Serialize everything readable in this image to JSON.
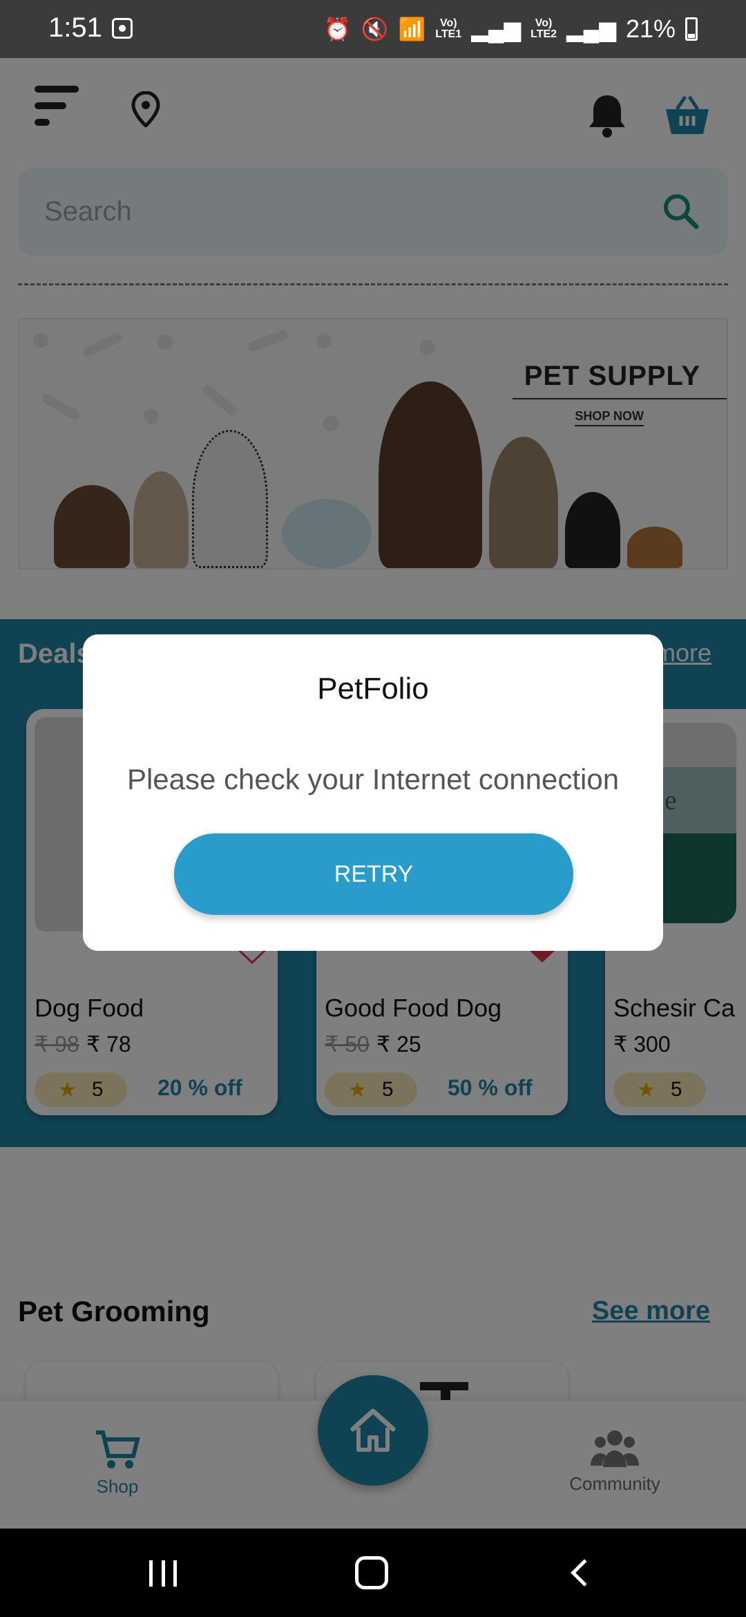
{
  "status_bar": {
    "time": "1:51",
    "battery": "21%"
  },
  "header": {
    "search_placeholder": "Search"
  },
  "banner": {
    "title": "PET SUPPLY",
    "cta": "SHOP NOW"
  },
  "deals": {
    "heading": "Deals",
    "see_more": "more",
    "products": [
      {
        "name": "Dog Food",
        "old_price": "₹ 98",
        "price": "₹ 78",
        "rating": "5",
        "discount": "20 % off",
        "favorited": false
      },
      {
        "name": "Good Food Dog",
        "old_price": "₹ 50",
        "price": "₹ 25",
        "rating": "5",
        "discount": "50 % off",
        "favorited": true
      },
      {
        "name": "Schesir Ca",
        "old_price": "",
        "price": "₹ 300",
        "rating": "5",
        "discount": "",
        "favorited": false
      }
    ],
    "can_brand": "Sche"
  },
  "grooming": {
    "heading": "Pet Grooming",
    "see_more": "See more"
  },
  "bottom_nav": {
    "shop": "Shop",
    "community": "Community"
  },
  "dialog": {
    "title": "PetFolio",
    "message": "Please check your Internet connection",
    "retry": "RETRY"
  },
  "colors": {
    "accent": "#1f86a8",
    "button": "#2a9ccc",
    "heart": "#e2334f",
    "rating_bg": "#f6e8b4"
  }
}
